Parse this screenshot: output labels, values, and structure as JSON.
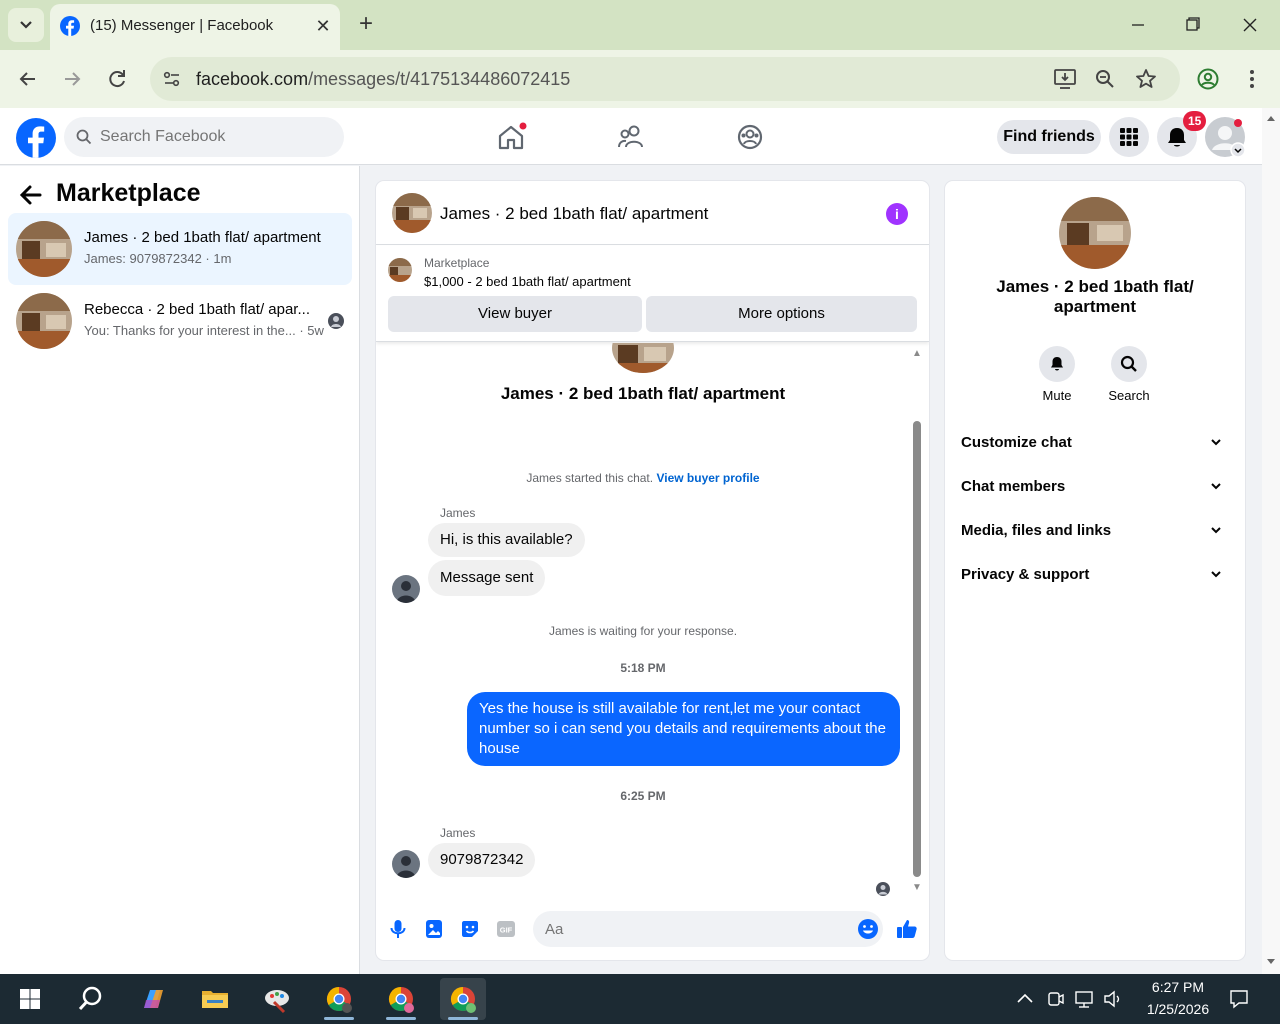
{
  "browser": {
    "tab_title": "(15) Messenger | Facebook",
    "url_host": "facebook.com",
    "url_path": "/messages/t/4175134486072415"
  },
  "header": {
    "search_placeholder": "Search Facebook",
    "find_friends": "Find friends",
    "notification_count": "15"
  },
  "sidebar": {
    "title": "Marketplace",
    "conversations": [
      {
        "name": "James · 2 bed 1bath flat/ apartment",
        "preview": "James: 9079872342 · 1m"
      },
      {
        "name": "Rebecca · 2 bed 1bath flat/ apar...",
        "preview": "You: Thanks for your interest in the... · 5w"
      }
    ]
  },
  "chat": {
    "title": "James · 2 bed 1bath flat/ apartment",
    "listing_label": "Marketplace",
    "listing_price": "$1,000 - 2 bed 1bath flat/ apartment",
    "view_buyer": "View buyer",
    "more_options": "More options",
    "intro_name": "James · 2 bed 1bath flat/ apartment",
    "started_text": "James started this chat.",
    "view_buyer_profile": "View buyer profile",
    "messages": [
      {
        "sender": "James",
        "text": "Hi, is this available?"
      },
      {
        "text": "Message sent"
      },
      {
        "text": "James is waiting for your response."
      },
      {
        "text": "5:18 PM"
      },
      {
        "text": "Yes the house is still available for rent,let me your contact number so i can send you details and requirements about the house"
      },
      {
        "text": "6:25 PM"
      },
      {
        "sender": "James",
        "text": "9079872342"
      }
    ],
    "input_placeholder": "Aa"
  },
  "right_panel": {
    "name": "James · 2 bed 1bath flat/ apartment",
    "actions": [
      "Mute",
      "Search"
    ],
    "sections": [
      "Customize chat",
      "Chat members",
      "Media, files and links",
      "Privacy & support"
    ]
  },
  "taskbar": {
    "time": "6:27 PM",
    "date": "1/25/2026"
  },
  "colors": {
    "fb_blue": "#0866ff",
    "outgoing_bubble": "#0a66ff",
    "badge_red": "#e41e3f",
    "info_purple": "#a033ff"
  }
}
